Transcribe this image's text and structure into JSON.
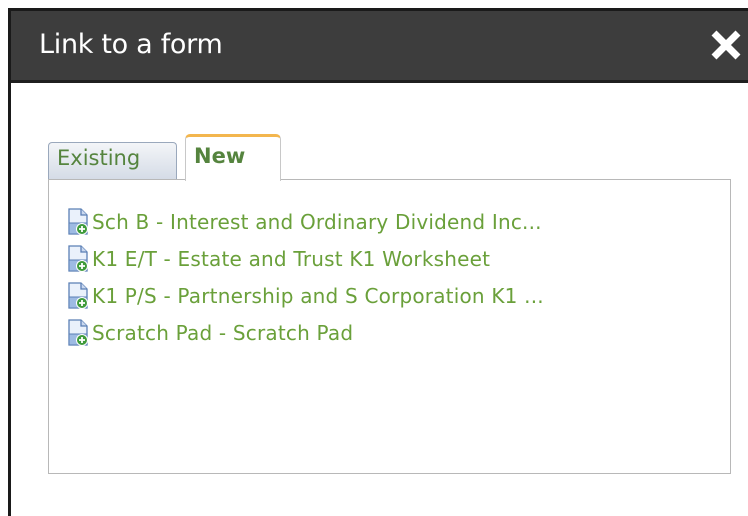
{
  "dialog": {
    "title": "Link to a form",
    "close_icon": "close-icon"
  },
  "tabs": [
    {
      "label": "Existing",
      "selected": false
    },
    {
      "label": "New",
      "selected": true
    }
  ],
  "forms": [
    {
      "label": "Sch B - Interest and Ordinary Dividend Inc...",
      "icon": "new-document-icon"
    },
    {
      "label": "K1 E/T - Estate and Trust K1 Worksheet",
      "icon": "new-document-icon"
    },
    {
      "label": "K1 P/S - Partnership and S Corporation K1 ...",
      "icon": "new-document-icon"
    },
    {
      "label": "Scratch Pad - Scratch Pad",
      "icon": "new-document-icon"
    }
  ],
  "colors": {
    "titlebar": "#3d3d3d",
    "link_text": "#6aa03a",
    "tab_text": "#55843e",
    "active_tab_accent": "#f3b64e"
  }
}
